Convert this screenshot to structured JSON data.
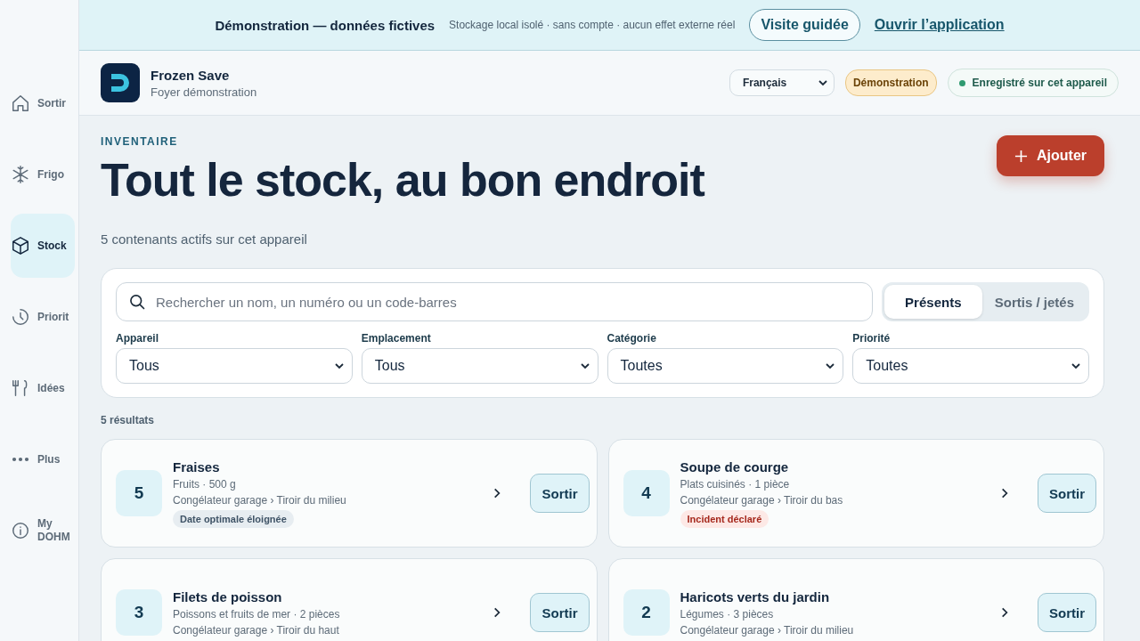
{
  "sidebar": {
    "items": [
      {
        "label": "Sortir",
        "kind": "home",
        "selected": false
      },
      {
        "label": "Frigo",
        "kind": "snow",
        "selected": false
      },
      {
        "label": "Stock",
        "kind": "box",
        "selected": true
      },
      {
        "label": "Priorit",
        "kind": "clock",
        "selected": false
      },
      {
        "label": "Idées",
        "kind": "fork",
        "selected": false
      },
      {
        "label": "Plus",
        "kind": "dots",
        "selected": false
      },
      {
        "label": "My DOHM",
        "kind": "info",
        "selected": false
      }
    ]
  },
  "banner": {
    "title": "Démonstration — données fictives",
    "note": "Stockage local isolé · sans compte · aucun effet externe réel",
    "tour_button": "Visite guidée",
    "open_link": "Ouvrir l’application"
  },
  "header": {
    "app_name": "Frozen Save",
    "household": "Foyer démonstration",
    "language": "Français",
    "demo_badge": "Démonstration",
    "saved_status": "Enregistré sur cet appareil"
  },
  "page": {
    "eyebrow": "INVENTAIRE",
    "title": "Tout le stock, au bon endroit",
    "subtitle": "5 contenants actifs sur cet appareil",
    "add_button": "Ajouter"
  },
  "filters": {
    "search": {
      "placeholder": "Rechercher un nom, un numéro ou un code-barres"
    },
    "tabs": [
      {
        "label": "Présents",
        "selected": true
      },
      {
        "label": "Sortis / jetés",
        "selected": false
      }
    ],
    "selects": [
      {
        "label": "Appareil",
        "value": "Tous"
      },
      {
        "label": "Emplacement",
        "value": "Tous"
      },
      {
        "label": "Catégorie",
        "value": "Toutes"
      },
      {
        "label": "Priorité",
        "value": "Toutes"
      }
    ]
  },
  "results_count": "5 résultats",
  "items": [
    {
      "number": "5",
      "name": "Fraises",
      "meta": "Fruits · 500 g",
      "location": "Congélateur garage › Tiroir du milieu",
      "tag": {
        "label": "Date optimale éloignée",
        "kind": "neutral"
      },
      "action": "Sortir"
    },
    {
      "number": "4",
      "name": "Soupe de courge",
      "meta": "Plats cuisinés · 1 pièce",
      "location": "Congélateur garage › Tiroir du bas",
      "tag": {
        "label": "Incident déclaré",
        "kind": "alert"
      },
      "action": "Sortir"
    },
    {
      "number": "3",
      "name": "Filets de poisson",
      "meta": "Poissons et fruits de mer · 2 pièces",
      "location": "Congélateur garage › Tiroir du haut",
      "action": "Sortir"
    },
    {
      "number": "2",
      "name": "Haricots verts du jardin",
      "meta": "Légumes · 3 pièces",
      "location": "Congélateur garage › Tiroir du milieu",
      "action": "Sortir"
    }
  ]
}
